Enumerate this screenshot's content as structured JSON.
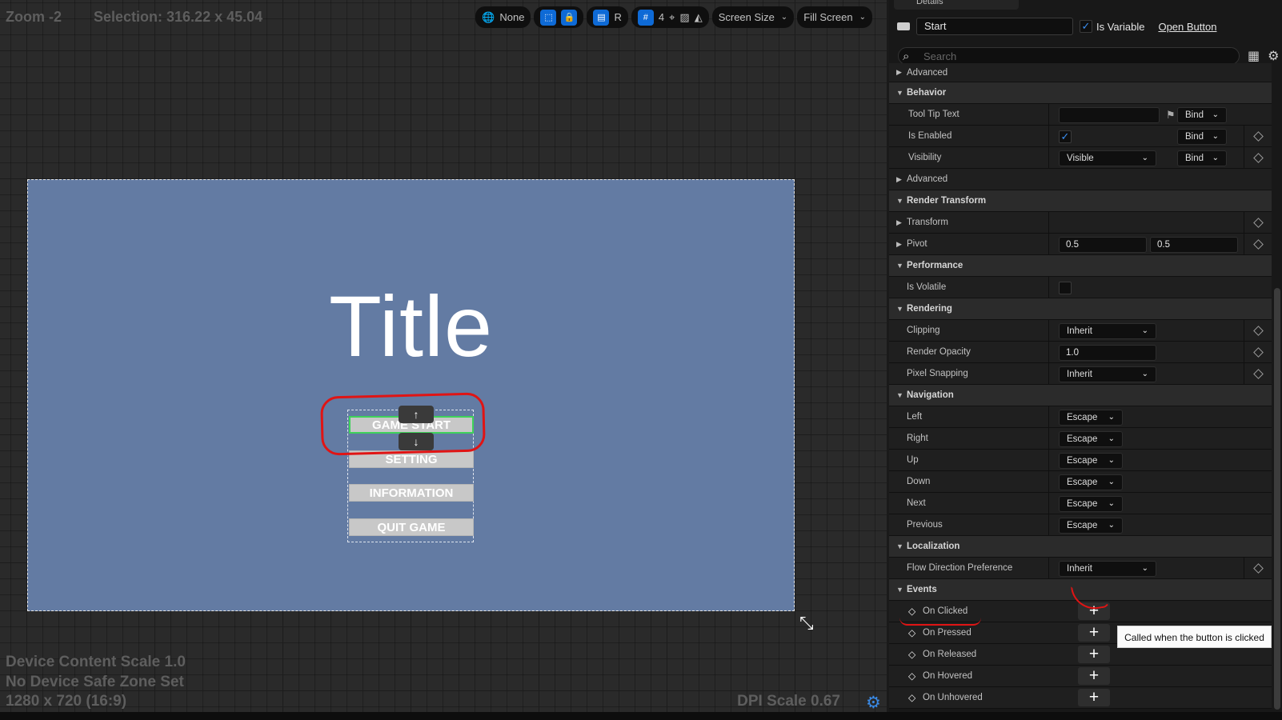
{
  "canvas": {
    "zoom": "Zoom -2",
    "selection": "Selection: 316.22 x 45.04",
    "toolbar": {
      "localization": "None",
      "r_toggle": "R",
      "grid_size": "4",
      "screen_size": "Screen Size",
      "fill_mode": "Fill Screen"
    },
    "widget": {
      "title": "Title",
      "buttons": [
        "GAME START",
        "SETTING",
        "INFORMATION",
        "QUIT GAME"
      ],
      "move_up": "↑",
      "move_down": "↓"
    },
    "info": {
      "content_scale": "Device Content Scale 1.0",
      "safe_zone": "No Device Safe Zone Set",
      "resolution": "1280 x 720 (16:9)",
      "dpi_scale": "DPI Scale 0.67"
    }
  },
  "details": {
    "tab_title": "Details",
    "widget_name": "Start",
    "is_variable_label": "Is Variable",
    "is_variable": true,
    "open_button_label": "Open Button",
    "search_placeholder": "Search",
    "rows": {
      "advanced_top": "Advanced",
      "behavior": "Behavior",
      "tooltip_text": "Tool Tip Text",
      "is_enabled": "Is Enabled",
      "visibility": "Visibility",
      "visibility_value": "Visible",
      "bind": "Bind",
      "advanced_behavior": "Advanced",
      "render_transform": "Render Transform",
      "transform": "Transform",
      "pivot": "Pivot",
      "pivot_x": "0.5",
      "pivot_y": "0.5",
      "performance": "Performance",
      "is_volatile": "Is Volatile",
      "rendering": "Rendering",
      "clipping": "Clipping",
      "clipping_value": "Inherit",
      "render_opacity": "Render Opacity",
      "render_opacity_value": "1.0",
      "pixel_snapping": "Pixel Snapping",
      "pixel_snapping_value": "Inherit",
      "navigation": "Navigation",
      "nav_items": [
        {
          "label": "Left",
          "value": "Escape"
        },
        {
          "label": "Right",
          "value": "Escape"
        },
        {
          "label": "Up",
          "value": "Escape"
        },
        {
          "label": "Down",
          "value": "Escape"
        },
        {
          "label": "Next",
          "value": "Escape"
        },
        {
          "label": "Previous",
          "value": "Escape"
        }
      ],
      "localization": "Localization",
      "flow_direction": "Flow Direction Preference",
      "flow_direction_value": "Inherit",
      "events": "Events",
      "event_items": [
        "On Clicked",
        "On Pressed",
        "On Released",
        "On Hovered",
        "On Unhovered"
      ]
    },
    "tooltip": "Called when the button is clicked"
  },
  "colors": {
    "viewport_bg": "#637ba3",
    "selection_outline": "#3fd25a",
    "annotation": "#e01414",
    "accent": "#0e6ad6"
  }
}
